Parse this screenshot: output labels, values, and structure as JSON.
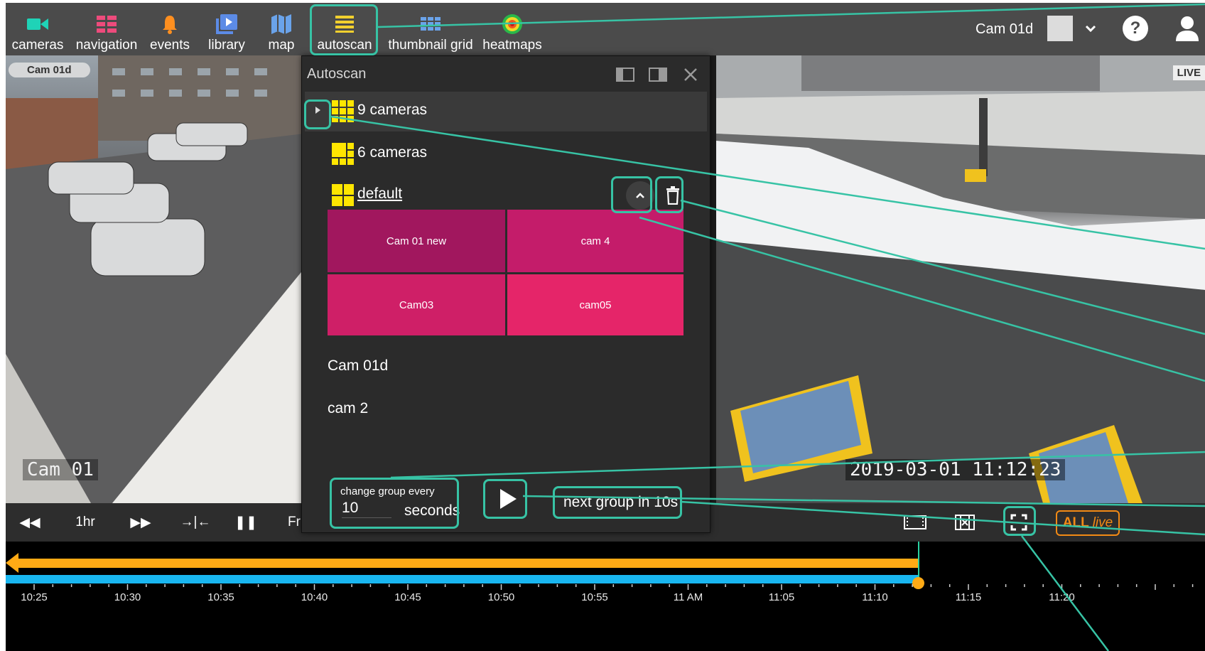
{
  "toolbar": {
    "items": [
      {
        "label": "cameras",
        "icon": "video-camera-icon"
      },
      {
        "label": "navigation",
        "icon": "navigation-icon"
      },
      {
        "label": "events",
        "icon": "bell-icon"
      },
      {
        "label": "library",
        "icon": "library-icon"
      },
      {
        "label": "map",
        "icon": "map-icon"
      },
      {
        "label": "autoscan",
        "icon": "autoscan-icon"
      },
      {
        "label": "thumbnail grid",
        "icon": "thumbnail-grid-icon"
      },
      {
        "label": "heatmaps",
        "icon": "heatmap-icon"
      }
    ],
    "camera_title": "Cam 01d"
  },
  "video": {
    "left_badge": "Cam 01d",
    "left_overlay_name": "Cam  01",
    "right_live_tag": "LIVE",
    "right_timestamp": "2019-03-01  11:12:23"
  },
  "controls": {
    "rewind_glyph": "◀◀",
    "range_label": "1hr",
    "forward_glyph": "▶▶",
    "sync_glyph": "→|←",
    "pause_glyph": "❚❚",
    "partial_label": "Fr",
    "all_label": "ALL",
    "live_label": "live"
  },
  "autoscan": {
    "title": "Autoscan",
    "groups": [
      {
        "label": "9 cameras",
        "expanded": false
      },
      {
        "label": "6 cameras",
        "expanded": false
      },
      {
        "label": "default",
        "expanded": true,
        "tiles": [
          "Cam 01 new",
          "cam 4",
          "Cam03",
          "cam05"
        ]
      }
    ],
    "cameras": [
      "Cam 01d",
      "cam 2"
    ],
    "change_group_label": "change group every",
    "interval_value": "10",
    "interval_unit": "seconds",
    "next_group_text": "next group in 10s",
    "tile_colors": [
      "#a1175e",
      "#c41c6a",
      "#cf1f67",
      "#e52569"
    ]
  },
  "timeline": {
    "labels": [
      "10:25",
      "10:30",
      "10:35",
      "10:40",
      "10:45",
      "10:50",
      "10:55",
      "11 AM",
      "11:05",
      "11:10",
      "11:15",
      "11:20"
    ]
  },
  "colors": {
    "highlight": "#37c3a5",
    "accent_orange": "#ffaa15",
    "timeline_blue": "#19b6f0",
    "group_icon_yellow": "#ffe600",
    "live_orange": "#f28a15"
  }
}
